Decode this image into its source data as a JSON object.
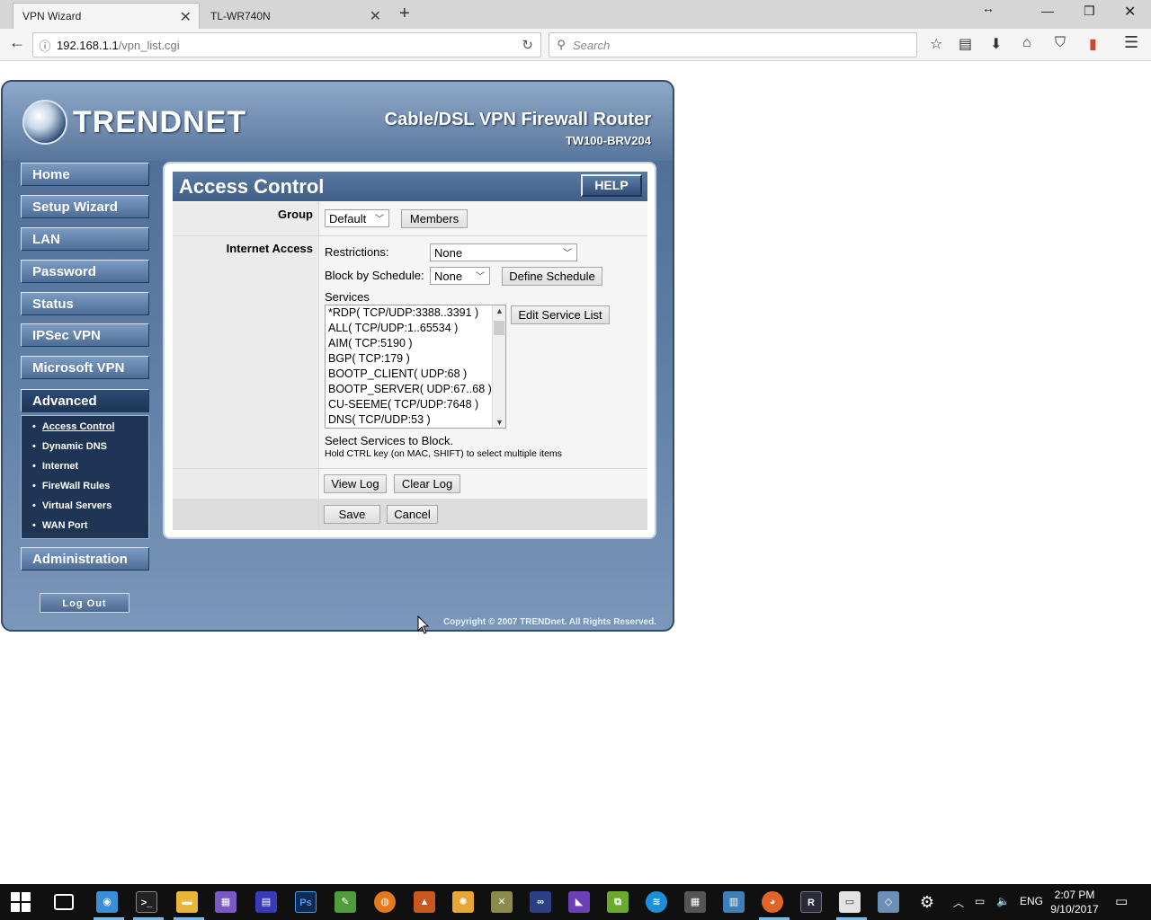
{
  "browser": {
    "tabs": [
      {
        "title": "VPN Wizard",
        "active": true
      },
      {
        "title": "TL-WR740N",
        "active": false
      }
    ],
    "url_host": "192.168.1.1",
    "url_path": "/vpn_list.cgi",
    "search_placeholder": "Search",
    "icons": [
      "back-icon",
      "info-icon",
      "reload-icon",
      "search-icon",
      "bookmark-star-icon",
      "reading-list-icon",
      "download-icon",
      "home-icon",
      "pocket-icon",
      "menu-icon"
    ]
  },
  "router": {
    "brand": "TRENDNET",
    "product": "Cable/DSL VPN Firewall Router",
    "model": "TW100-BRV204",
    "menu": {
      "home": "Home",
      "setup_wizard": "Setup Wizard",
      "lan": "LAN",
      "password": "Password",
      "status": "Status",
      "ipsec_vpn": "IPSec VPN",
      "microsoft_vpn": "Microsoft VPN",
      "advanced": "Advanced",
      "administration": "Administration"
    },
    "submenu": {
      "access_control": "Access Control",
      "dynamic_dns": "Dynamic DNS",
      "internet": "Internet",
      "firewall_rules": "FireWall Rules",
      "virtual_servers": "Virtual Servers",
      "wan_port": "WAN Port"
    },
    "logout": "Log Out",
    "copyright": "Copyright © 2007 TRENDnet. All Rights Reserved."
  },
  "panel": {
    "title": "Access Control",
    "help": "HELP",
    "group_label": "Group",
    "group_value": "Default",
    "members_button": "Members",
    "internet_access_label": "Internet Access",
    "restrictions_label": "Restrictions:",
    "restrictions_value": "None",
    "block_schedule_label": "Block by Schedule:",
    "block_schedule_value": "None",
    "define_schedule_button": "Define Schedule",
    "services_label": "Services",
    "services": {
      "s0": "*RDP( TCP/UDP:3388..3391 )",
      "s1": "ALL( TCP/UDP:1..65534 )",
      "s2": "AIM( TCP:5190 )",
      "s3": "BGP( TCP:179 )",
      "s4": "BOOTP_CLIENT( UDP:68 )",
      "s5": "BOOTP_SERVER( UDP:67..68 )",
      "s6": "CU-SEEME( TCP/UDP:7648 )",
      "s7": "DNS( TCP/UDP:53 )"
    },
    "edit_service_button": "Edit Service List",
    "select_services_text": "Select Services to Block.",
    "hold_ctrl_text": "Hold CTRL key (on MAC, SHIFT) to select multiple items",
    "view_log_button": "View Log",
    "clear_log_button": "Clear Log",
    "save_button": "Save",
    "cancel_button": "Cancel"
  },
  "taskbar": {
    "lang": "ENG",
    "time": "2:07 PM",
    "date": "9/10/2017",
    "ps_label": "Ps"
  }
}
